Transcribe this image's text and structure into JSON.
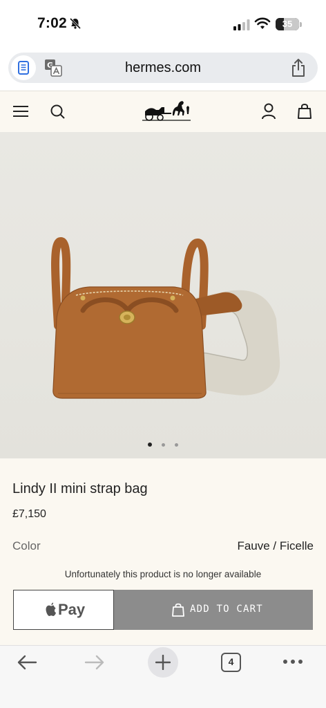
{
  "status_bar": {
    "time": "7:02",
    "battery_level": "35"
  },
  "browser": {
    "host": "hermes.com"
  },
  "product": {
    "title": "Lindy II mini strap bag",
    "price": "£7,150",
    "color_label": "Color",
    "color_value": "Fauve / Ficelle",
    "availability_note": "Unfortunately this product is no longer available",
    "add_to_cart_label": "ADD TO CART",
    "apple_pay_label": "Pay",
    "gallery_active_index": 1,
    "gallery_count": 3
  },
  "toolbar": {
    "tab_count": "4"
  },
  "colors": {
    "page_background": "#fbf8f1",
    "disabled_button": "#8c8c8c",
    "bag_leather": "#b06a32",
    "strap_canvas": "#d8d4c8"
  }
}
